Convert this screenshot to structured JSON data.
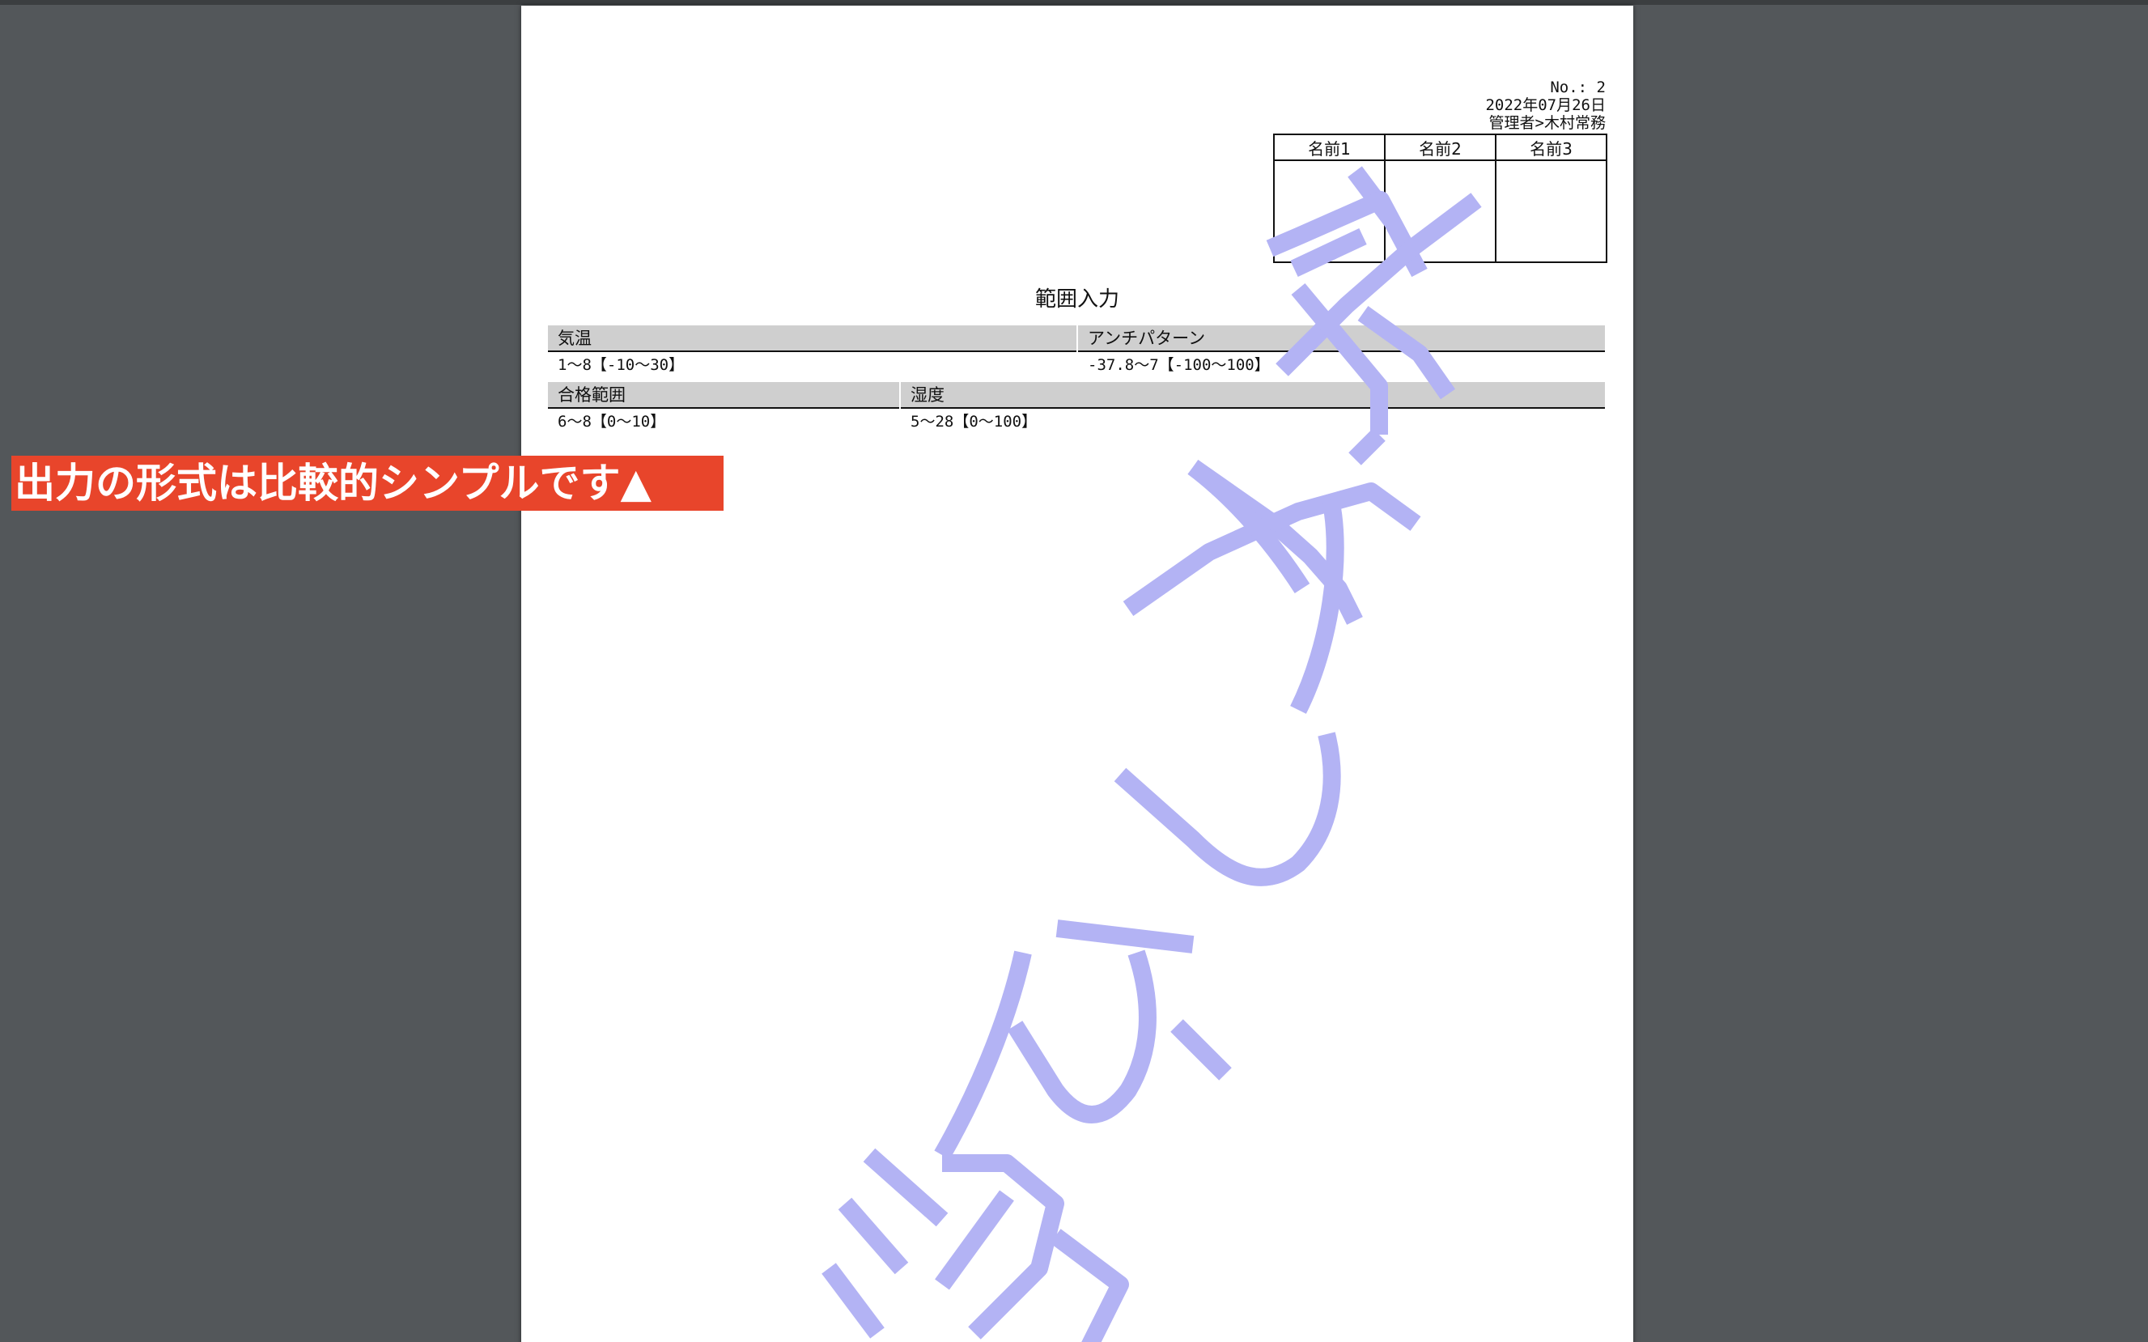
{
  "document": {
    "no": "No.: 2",
    "date": "2022年07月26日",
    "manager": "管理者>木村常務",
    "stamp_headers": [
      "名前1",
      "名前2",
      "名前3"
    ],
    "title": "範囲入力",
    "rows": [
      {
        "cells": [
          {
            "label": "気温",
            "value": "1～8【-10～30】"
          },
          {
            "label": "アンチパターン",
            "value": "-37.8～7【-100～100】"
          }
        ]
      },
      {
        "cells": [
          {
            "label": "合格範囲",
            "value": "6～8【0～10】"
          },
          {
            "label": "湿度",
            "value": "5～28【0～100】"
          }
        ]
      }
    ],
    "watermark_text": "透かし文字",
    "watermark_color": "#b3b3f4"
  },
  "callout": {
    "text": "出力の形式は比較的シンプルです▲",
    "color": "#e8452b"
  }
}
